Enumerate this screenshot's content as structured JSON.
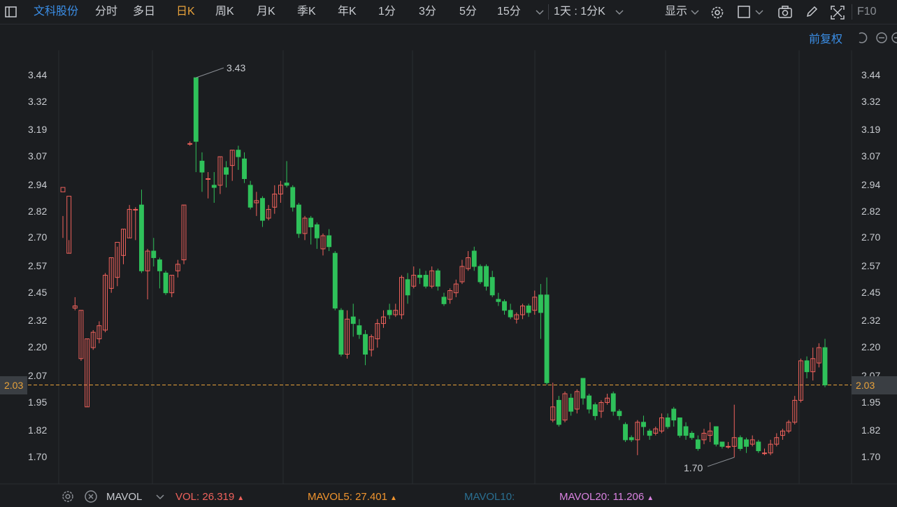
{
  "toolbar": {
    "stock_name": "文科股份",
    "tabs": [
      "分时",
      "多日",
      "日K",
      "周K",
      "月K",
      "季K",
      "年K",
      "1分",
      "3分",
      "5分",
      "15分"
    ],
    "active_tab": "日K",
    "period_select": "1天 : 1分K",
    "display_label": "显示",
    "f10_label": "F10"
  },
  "adjust_label": "前复权",
  "price_axis": {
    "ticks": [
      "3.44",
      "3.32",
      "3.19",
      "3.07",
      "2.94",
      "2.82",
      "2.70",
      "2.57",
      "2.45",
      "2.32",
      "2.20",
      "2.07",
      "1.95",
      "1.82",
      "1.70"
    ],
    "current_price": "2.03",
    "current_color": "#e8a23b"
  },
  "annotations": {
    "high_label": "3.43",
    "low_label": "1.70"
  },
  "chart_data": {
    "type": "candlestick",
    "ylim": [
      1.62,
      3.52
    ],
    "up_color": "#f0625c",
    "down_color": "#2fc15a",
    "ohlc": [
      [
        2.91,
        2.93,
        2.8,
        2.7
      ],
      [
        2.63,
        2.89,
        2.69,
        2.63
      ],
      [
        2.38,
        2.39,
        2.43,
        2.37
      ],
      [
        2.15,
        2.37,
        2.37,
        2.14
      ],
      [
        1.93,
        2.24,
        2.24,
        1.93
      ],
      [
        2.2,
        2.27,
        2.28,
        2.19
      ],
      [
        2.24,
        2.3,
        2.32,
        2.22
      ],
      [
        2.28,
        2.53,
        2.54,
        2.27
      ],
      [
        2.47,
        2.61,
        2.61,
        2.45
      ],
      [
        2.52,
        2.68,
        2.66,
        2.48
      ],
      [
        2.62,
        2.74,
        2.74,
        2.58
      ],
      [
        2.7,
        2.83,
        2.85,
        2.7
      ],
      [
        2.83,
        2.83,
        2.84,
        2.69
      ],
      [
        2.85,
        2.55,
        2.92,
        2.54
      ],
      [
        2.55,
        2.64,
        2.65,
        2.42
      ],
      [
        2.64,
        2.61,
        2.7,
        2.57
      ],
      [
        2.6,
        2.55,
        2.61,
        2.47
      ],
      [
        2.54,
        2.45,
        2.55,
        2.44
      ],
      [
        2.45,
        2.53,
        2.53,
        2.43
      ],
      [
        2.55,
        2.58,
        2.6,
        2.52
      ],
      [
        2.6,
        2.85,
        2.85,
        2.58
      ],
      [
        3.13,
        3.13,
        3.14,
        3.12
      ],
      [
        3.43,
        3.14,
        3.43,
        3.0
      ],
      [
        3.05,
        3.0,
        3.09,
        2.91
      ],
      [
        2.97,
        2.97,
        3.0,
        2.88
      ],
      [
        2.94,
        2.93,
        3.0,
        2.86
      ],
      [
        2.94,
        3.07,
        3.07,
        2.9
      ],
      [
        3.02,
        2.99,
        3.05,
        2.93
      ],
      [
        3.03,
        3.1,
        3.1,
        2.96
      ],
      [
        3.1,
        3.07,
        3.12,
        3.01
      ],
      [
        3.06,
        2.97,
        3.09,
        2.95
      ],
      [
        2.94,
        2.84,
        2.96,
        2.83
      ],
      [
        2.86,
        2.87,
        2.91,
        2.8
      ],
      [
        2.88,
        2.78,
        2.89,
        2.75
      ],
      [
        2.79,
        2.83,
        2.85,
        2.78
      ],
      [
        2.84,
        2.9,
        2.94,
        2.81
      ],
      [
        2.9,
        2.94,
        2.96,
        2.86
      ],
      [
        2.95,
        2.94,
        3.05,
        2.93
      ],
      [
        2.93,
        2.84,
        2.94,
        2.82
      ],
      [
        2.85,
        2.72,
        2.86,
        2.7
      ],
      [
        2.72,
        2.79,
        2.8,
        2.69
      ],
      [
        2.79,
        2.75,
        2.8,
        2.67
      ],
      [
        2.76,
        2.7,
        2.77,
        2.65
      ],
      [
        2.65,
        2.71,
        2.72,
        2.62
      ],
      [
        2.71,
        2.66,
        2.74,
        2.64
      ],
      [
        2.63,
        2.38,
        2.64,
        2.37
      ],
      [
        2.37,
        2.17,
        2.38,
        2.16
      ],
      [
        2.17,
        2.33,
        2.37,
        2.15
      ],
      [
        2.34,
        2.31,
        2.4,
        2.25
      ],
      [
        2.3,
        2.26,
        2.33,
        2.24
      ],
      [
        2.26,
        2.17,
        2.28,
        2.12
      ],
      [
        2.19,
        2.25,
        2.26,
        2.16
      ],
      [
        2.24,
        2.31,
        2.33,
        2.2
      ],
      [
        2.31,
        2.34,
        2.37,
        2.29
      ],
      [
        2.37,
        2.35,
        2.4,
        2.33
      ],
      [
        2.35,
        2.37,
        2.4,
        2.34
      ],
      [
        2.35,
        2.52,
        2.53,
        2.33
      ],
      [
        2.51,
        2.44,
        2.54,
        2.4
      ],
      [
        2.48,
        2.53,
        2.57,
        2.47
      ],
      [
        2.53,
        2.52,
        2.56,
        2.49
      ],
      [
        2.53,
        2.48,
        2.55,
        2.47
      ],
      [
        2.48,
        2.55,
        2.57,
        2.47
      ],
      [
        2.55,
        2.48,
        2.56,
        2.46
      ],
      [
        2.43,
        2.4,
        2.45,
        2.39
      ],
      [
        2.42,
        2.46,
        2.47,
        2.4
      ],
      [
        2.45,
        2.49,
        2.51,
        2.43
      ],
      [
        2.5,
        2.57,
        2.6,
        2.49
      ],
      [
        2.56,
        2.61,
        2.64,
        2.55
      ],
      [
        2.64,
        2.57,
        2.66,
        2.55
      ],
      [
        2.57,
        2.5,
        2.58,
        2.49
      ],
      [
        2.57,
        2.48,
        2.58,
        2.46
      ],
      [
        2.52,
        2.44,
        2.55,
        2.43
      ],
      [
        2.42,
        2.41,
        2.45,
        2.39
      ],
      [
        2.41,
        2.37,
        2.42,
        2.35
      ],
      [
        2.37,
        2.34,
        2.4,
        2.33
      ],
      [
        2.33,
        2.35,
        2.36,
        2.31
      ],
      [
        2.35,
        2.39,
        2.4,
        2.33
      ],
      [
        2.39,
        2.36,
        2.4,
        2.34
      ],
      [
        2.37,
        2.43,
        2.46,
        2.35
      ],
      [
        2.44,
        2.36,
        2.49,
        2.24
      ],
      [
        2.44,
        2.04,
        2.52,
        2.03
      ],
      [
        1.87,
        1.93,
        2.04,
        1.86
      ],
      [
        1.96,
        1.85,
        1.98,
        1.84
      ],
      [
        1.87,
        1.99,
        2.0,
        1.86
      ],
      [
        1.97,
        1.91,
        1.99,
        1.89
      ],
      [
        1.92,
        2.0,
        2.01,
        1.9
      ],
      [
        2.06,
        1.97,
        2.06,
        1.94
      ],
      [
        1.98,
        1.92,
        1.99,
        1.9
      ],
      [
        1.94,
        1.89,
        1.95,
        1.87
      ],
      [
        1.91,
        1.95,
        1.96,
        1.88
      ],
      [
        1.95,
        1.97,
        1.99,
        1.94
      ],
      [
        1.99,
        1.91,
        2.0,
        1.89
      ],
      [
        1.91,
        1.89,
        1.92,
        1.87
      ],
      [
        1.85,
        1.78,
        1.86,
        1.77
      ],
      [
        1.79,
        1.78,
        1.8,
        1.77
      ],
      [
        1.78,
        1.86,
        1.87,
        1.71
      ],
      [
        1.86,
        1.84,
        1.89,
        1.8
      ],
      [
        1.82,
        1.8,
        1.83,
        1.78
      ],
      [
        1.81,
        1.83,
        1.84,
        1.8
      ],
      [
        1.82,
        1.88,
        1.9,
        1.81
      ],
      [
        1.88,
        1.84,
        1.9,
        1.83
      ],
      [
        1.92,
        1.87,
        1.93,
        1.84
      ],
      [
        1.88,
        1.8,
        1.88,
        1.79
      ],
      [
        1.84,
        1.8,
        1.86,
        1.78
      ],
      [
        1.81,
        1.79,
        1.82,
        1.78
      ],
      [
        1.78,
        1.74,
        1.8,
        1.73
      ],
      [
        1.78,
        1.81,
        1.83,
        1.76
      ],
      [
        1.8,
        1.82,
        1.86,
        1.77
      ],
      [
        1.84,
        1.76,
        1.84,
        1.75
      ],
      [
        1.77,
        1.75,
        1.77,
        1.74
      ],
      [
        1.75,
        1.75,
        1.77,
        1.74
      ],
      [
        1.75,
        1.79,
        1.94,
        1.7
      ],
      [
        1.79,
        1.74,
        1.8,
        1.73
      ],
      [
        1.78,
        1.75,
        1.79,
        1.72
      ],
      [
        1.76,
        1.78,
        1.8,
        1.75
      ],
      [
        1.77,
        1.73,
        1.78,
        1.72
      ],
      [
        1.72,
        1.72,
        1.74,
        1.71
      ],
      [
        1.72,
        1.76,
        1.78,
        1.71
      ],
      [
        1.76,
        1.79,
        1.81,
        1.75
      ],
      [
        1.8,
        1.82,
        1.83,
        1.78
      ],
      [
        1.82,
        1.86,
        1.87,
        1.81
      ],
      [
        1.86,
        1.96,
        1.98,
        1.85
      ],
      [
        1.96,
        2.14,
        2.15,
        1.95
      ],
      [
        2.14,
        2.09,
        2.16,
        2.06
      ],
      [
        2.09,
        2.15,
        2.2,
        2.05
      ],
      [
        2.13,
        2.2,
        2.22,
        2.11
      ],
      [
        2.2,
        2.03,
        2.24,
        2.02
      ]
    ],
    "indicator": "MAVOL",
    "vol": {
      "label": "VOL:",
      "value": "26.319",
      "color": "#f0625c"
    },
    "mavol5": {
      "label": "MAVOL5:",
      "value": "27.401",
      "color": "#f0942e"
    },
    "mavol10": {
      "label": "MAVOL10:",
      "value": "",
      "color": "#2a6f91"
    },
    "mavol20": {
      "label": "MAVOL20:",
      "value": "11.206",
      "color": "#d982e0"
    }
  }
}
